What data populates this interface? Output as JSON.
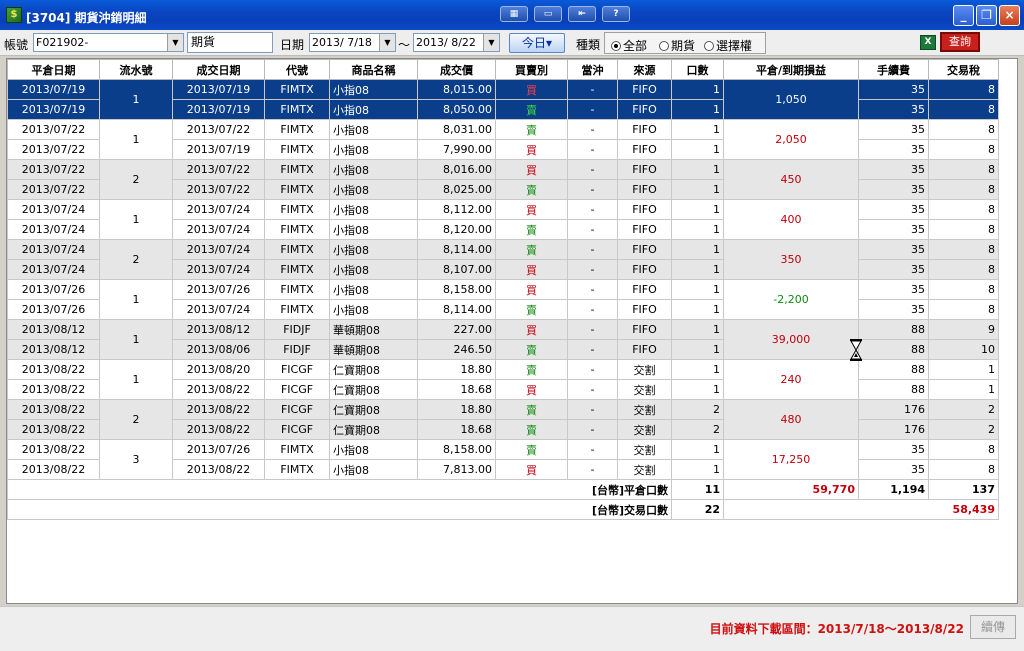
{
  "window": {
    "title": "[3704] 期貨沖銷明細",
    "icon_name": "app-icon",
    "tool_icons": [
      "layout-icon",
      "window-icon",
      "export-icon",
      "help-icon"
    ],
    "controls": [
      "minimize-icon",
      "restore-icon",
      "close-icon"
    ]
  },
  "toolbar": {
    "account_label": "帳號",
    "account_value": "F021902-",
    "product_value": "期貨",
    "date_label": "日期",
    "date_from": "2013/ 7/18",
    "tilde": "～",
    "date_to": "2013/ 8/22",
    "today_label": "今日▾",
    "kind_label": "種類",
    "radio_all": "全部",
    "radio_futures": "期貨",
    "radio_options": "選擇權",
    "selected_kind": "全部",
    "query_label": "查詢"
  },
  "table": {
    "headers": [
      "平倉日期",
      "流水號",
      "成交日期",
      "代號",
      "商品名稱",
      "成交價",
      "買賣別",
      "當沖",
      "來源",
      "口數",
      "平倉/到期損益",
      "手續費",
      "交易稅"
    ],
    "groups": [
      {
        "seq": "1",
        "pnl": "1,050",
        "shade": "sel",
        "rows": [
          [
            "2013/07/19",
            "2013/07/19",
            "FIMTX",
            "小指08",
            "8,015.00",
            "買",
            "-",
            "FIFO",
            "1",
            "35",
            "8"
          ],
          [
            "2013/07/19",
            "2013/07/19",
            "FIMTX",
            "小指08",
            "8,050.00",
            "賣",
            "-",
            "FIFO",
            "1",
            "35",
            "8"
          ]
        ]
      },
      {
        "seq": "1",
        "pnl": "2,050",
        "shade": "white",
        "rows": [
          [
            "2013/07/22",
            "2013/07/22",
            "FIMTX",
            "小指08",
            "8,031.00",
            "賣",
            "-",
            "FIFO",
            "1",
            "35",
            "8"
          ],
          [
            "2013/07/22",
            "2013/07/19",
            "FIMTX",
            "小指08",
            "7,990.00",
            "買",
            "-",
            "FIFO",
            "1",
            "35",
            "8"
          ]
        ]
      },
      {
        "seq": "2",
        "pnl": "450",
        "shade": "gray",
        "rows": [
          [
            "2013/07/22",
            "2013/07/22",
            "FIMTX",
            "小指08",
            "8,016.00",
            "買",
            "-",
            "FIFO",
            "1",
            "35",
            "8"
          ],
          [
            "2013/07/22",
            "2013/07/22",
            "FIMTX",
            "小指08",
            "8,025.00",
            "賣",
            "-",
            "FIFO",
            "1",
            "35",
            "8"
          ]
        ]
      },
      {
        "seq": "1",
        "pnl": "400",
        "shade": "white",
        "rows": [
          [
            "2013/07/24",
            "2013/07/24",
            "FIMTX",
            "小指08",
            "8,112.00",
            "買",
            "-",
            "FIFO",
            "1",
            "35",
            "8"
          ],
          [
            "2013/07/24",
            "2013/07/24",
            "FIMTX",
            "小指08",
            "8,120.00",
            "賣",
            "-",
            "FIFO",
            "1",
            "35",
            "8"
          ]
        ]
      },
      {
        "seq": "2",
        "pnl": "350",
        "shade": "gray",
        "rows": [
          [
            "2013/07/24",
            "2013/07/24",
            "FIMTX",
            "小指08",
            "8,114.00",
            "賣",
            "-",
            "FIFO",
            "1",
            "35",
            "8"
          ],
          [
            "2013/07/24",
            "2013/07/24",
            "FIMTX",
            "小指08",
            "8,107.00",
            "買",
            "-",
            "FIFO",
            "1",
            "35",
            "8"
          ]
        ]
      },
      {
        "seq": "1",
        "pnl": "-2,200",
        "shade": "white",
        "rows": [
          [
            "2013/07/26",
            "2013/07/26",
            "FIMTX",
            "小指08",
            "8,158.00",
            "買",
            "-",
            "FIFO",
            "1",
            "35",
            "8"
          ],
          [
            "2013/07/26",
            "2013/07/24",
            "FIMTX",
            "小指08",
            "8,114.00",
            "賣",
            "-",
            "FIFO",
            "1",
            "35",
            "8"
          ]
        ]
      },
      {
        "seq": "1",
        "pnl": "39,000",
        "shade": "gray",
        "rows": [
          [
            "2013/08/12",
            "2013/08/12",
            "FIDJF",
            "華頓期08",
            "227.00",
            "買",
            "-",
            "FIFO",
            "1",
            "88",
            "9"
          ],
          [
            "2013/08/12",
            "2013/08/06",
            "FIDJF",
            "華頓期08",
            "246.50",
            "賣",
            "-",
            "FIFO",
            "1",
            "88",
            "10"
          ]
        ]
      },
      {
        "seq": "1",
        "pnl": "240",
        "shade": "white",
        "rows": [
          [
            "2013/08/22",
            "2013/08/20",
            "FICGF",
            "仁寶期08",
            "18.80",
            "賣",
            "-",
            "交割",
            "1",
            "88",
            "1"
          ],
          [
            "2013/08/22",
            "2013/08/22",
            "FICGF",
            "仁寶期08",
            "18.68",
            "買",
            "-",
            "交割",
            "1",
            "88",
            "1"
          ]
        ]
      },
      {
        "seq": "2",
        "pnl": "480",
        "shade": "gray",
        "rows": [
          [
            "2013/08/22",
            "2013/08/22",
            "FICGF",
            "仁寶期08",
            "18.80",
            "賣",
            "-",
            "交割",
            "2",
            "176",
            "2"
          ],
          [
            "2013/08/22",
            "2013/08/22",
            "FICGF",
            "仁寶期08",
            "18.68",
            "賣",
            "-",
            "交割",
            "2",
            "176",
            "2"
          ]
        ]
      },
      {
        "seq": "3",
        "pnl": "17,250",
        "shade": "white",
        "rows": [
          [
            "2013/08/22",
            "2013/07/26",
            "FIMTX",
            "小指08",
            "8,158.00",
            "賣",
            "-",
            "交割",
            "1",
            "35",
            "8"
          ],
          [
            "2013/08/22",
            "2013/08/22",
            "FIMTX",
            "小指08",
            "7,813.00",
            "買",
            "-",
            "交割",
            "1",
            "35",
            "8"
          ]
        ]
      }
    ],
    "summary": {
      "close_label": "[台幣]平倉口數",
      "close_qty": "11",
      "close_pnl": "59,770",
      "close_fee": "1,194",
      "close_tax": "137",
      "trade_label": "[台幣]交易口數",
      "trade_qty": "22",
      "trade_total": "58,439"
    }
  },
  "status": {
    "text": "目前資料下載區間：2013/7/18～2013/8/22",
    "resend_label": "續傳"
  }
}
